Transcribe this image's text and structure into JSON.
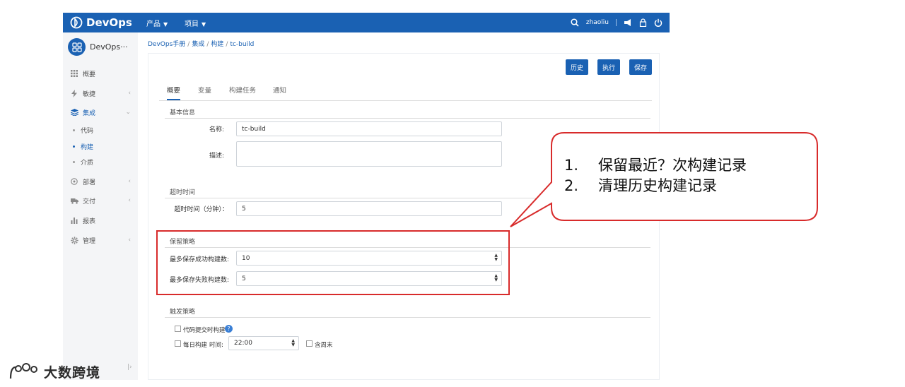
{
  "topbar": {
    "logo": "DevOps",
    "nav": [
      {
        "label": "产品"
      },
      {
        "label": "项目"
      }
    ],
    "user": "zhaoliu"
  },
  "sidebar": {
    "project_name": "DevOps···",
    "items": [
      {
        "label": "概要",
        "icon": "grid-icon"
      },
      {
        "label": "敏捷",
        "icon": "bolt-icon"
      },
      {
        "label": "集成",
        "icon": "layers-icon"
      },
      {
        "label": "部署",
        "icon": "target-icon"
      },
      {
        "label": "交付",
        "icon": "truck-icon"
      },
      {
        "label": "报表",
        "icon": "bar-chart-icon"
      },
      {
        "label": "管理",
        "icon": "gear-icon"
      }
    ],
    "sub_items": [
      {
        "label": "代码"
      },
      {
        "label": "构建"
      },
      {
        "label": "介质"
      }
    ]
  },
  "breadcrumb": [
    "DevOps手册",
    "集成",
    "构建",
    "tc-build"
  ],
  "toolbar": {
    "history": "历史",
    "run": "执行",
    "save": "保存"
  },
  "tabs": [
    "概要",
    "变量",
    "构建任务",
    "通知"
  ],
  "basic": {
    "title": "基本信息",
    "name_label": "名称:",
    "name_value": "tc-build",
    "desc_label": "描述:"
  },
  "timeout": {
    "title": "超时时间",
    "label": "超时时间（分钟）：",
    "value": "5"
  },
  "retention": {
    "title": "保留策略",
    "success_label": "最多保存成功构建数:",
    "success_value": "10",
    "fail_label": "最多保存失败构建数:",
    "fail_value": "5"
  },
  "trigger": {
    "title": "触发策略",
    "commit_label": "代码提交时构建",
    "daily_label": "每日构建",
    "time_label": "时间:",
    "time_value": "22:00",
    "weekend_label": "含周末"
  },
  "callout": {
    "items": [
      {
        "n": "1.",
        "text": "保留最近？次构建记录"
      },
      {
        "n": "2.",
        "text": "清理历史构建记录"
      }
    ]
  },
  "corner_logo": "大数跨境",
  "colors": {
    "primary": "#1a61b3",
    "highlight": "#d82b2b"
  }
}
